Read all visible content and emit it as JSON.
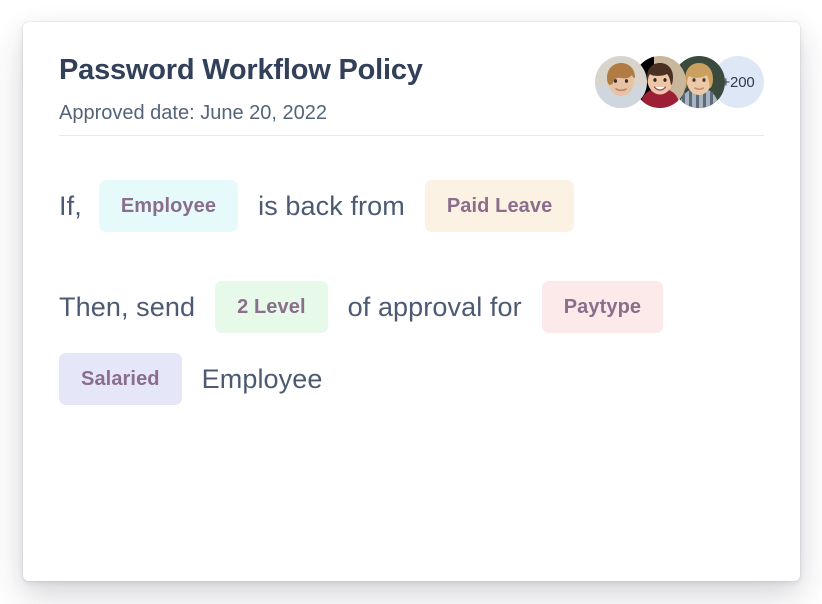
{
  "card": {
    "title": "Password Workflow Policy",
    "approved_date_label": "Approved date: June 20, 2022"
  },
  "avatars": {
    "more_count_label": "+200",
    "people": [
      {
        "alt": "avatar-person-1",
        "hair": "#b07c43",
        "skin": "#e8c2a4",
        "shirt": "#cfd6dd",
        "bg": "#d8d3cb"
      },
      {
        "alt": "avatar-person-2",
        "hair": "#4a2f22",
        "skin": "#edc6a8",
        "shirt": "#9c1f36",
        "bg": "#c9b79c"
      },
      {
        "alt": "avatar-person-3",
        "hair": "#caa05f",
        "skin": "#eccaa8",
        "shirt": "#5b6b7d",
        "bg": "#3a4a3d"
      }
    ]
  },
  "rule": {
    "line1": {
      "prefix": "If,",
      "chip_subject": "Employee",
      "middle": "is back from",
      "chip_status": "Paid Leave"
    },
    "line2": {
      "prefix": "Then, send",
      "chip_level": "2 Level",
      "middle": "of approval for",
      "chip_category": "Paytype"
    },
    "line3": {
      "chip_type": "Salaried",
      "suffix": "Employee"
    }
  },
  "colors": {
    "title": "#33405a",
    "body_text": "#4c5a72",
    "chip_text": "#8a6e8c",
    "chip_employee_bg": "#e6fafc",
    "chip_paidleave_bg": "#fcf2e4",
    "chip_2level_bg": "#e7fae9",
    "chip_paytype_bg": "#fce9ea",
    "chip_salaried_bg": "#e6e6f9",
    "badge_bg": "#dde7f6",
    "divider": "#e8e8ef"
  }
}
